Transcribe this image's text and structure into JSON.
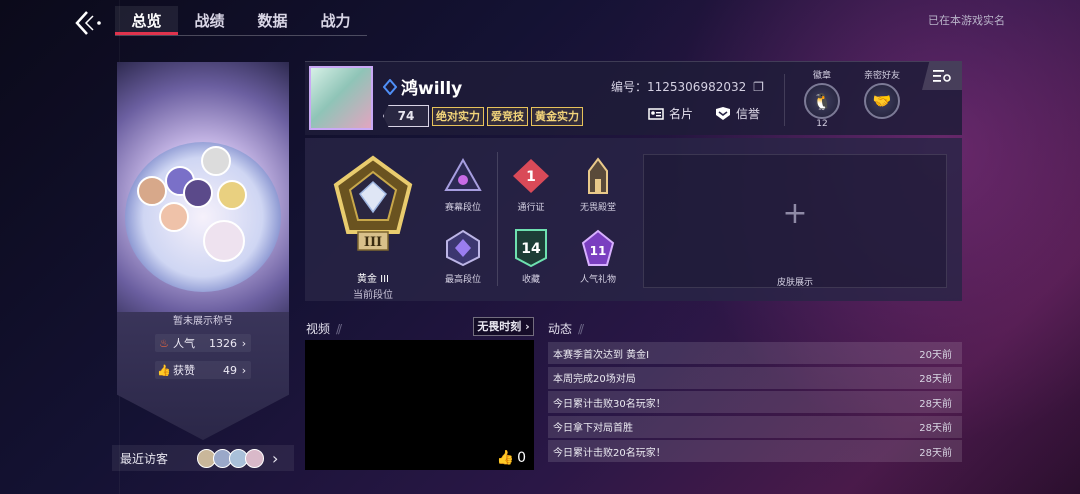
{
  "nav": {
    "tabs": [
      {
        "label": "总览",
        "active": true
      },
      {
        "label": "战绩",
        "active": false
      },
      {
        "label": "数据",
        "active": false
      },
      {
        "label": "战力",
        "active": false
      }
    ],
    "realname_status": "已在本游戏实名"
  },
  "card": {
    "title_text": "暂未展示称号",
    "popularity_label": "人气",
    "popularity_value": "1326",
    "likes_label": "获赞",
    "likes_value": "49",
    "recent_visitors_label": "最近访客"
  },
  "profile": {
    "name": "鸿willy",
    "level": "74",
    "tags": [
      "绝对实力",
      "爱竞技",
      "黄金实力"
    ],
    "id_label": "编号：1125306982032",
    "card_button": "名片",
    "credit_button": "信誉",
    "badge_label": "徽章",
    "badge_count": "12",
    "friends_label": "亲密好友"
  },
  "ranks": {
    "current_rank": "黄金 III",
    "current_rank_label": "当前段位",
    "season_rank_label": "赛幕段位",
    "highest_rank_label": "最高段位",
    "battle_pass_label": "通行证",
    "battle_pass_value": "1",
    "hall_label": "无畏殿堂",
    "collection_label": "收藏",
    "collection_value": "14",
    "gift_label": "人气礼物",
    "gift_value": "11",
    "skin_label": "皮肤展示"
  },
  "video": {
    "section_title": "视频",
    "link_label": "无畏时刻",
    "likes": "0"
  },
  "feed": {
    "section_title": "动态",
    "items": [
      {
        "text": "本赛季首次达到 黄金I",
        "time": "20天前"
      },
      {
        "text": "本周完成20场对局",
        "time": "28天前"
      },
      {
        "text": "今日累计击败30名玩家！",
        "time": "28天前"
      },
      {
        "text": "今日拿下对局首胜",
        "time": "28天前"
      },
      {
        "text": "今日累计击败20名玩家！",
        "time": "28天前"
      }
    ]
  },
  "colors": {
    "accent_red": "#e0334d",
    "gold": "#e7c25a",
    "panel": "#282446"
  }
}
